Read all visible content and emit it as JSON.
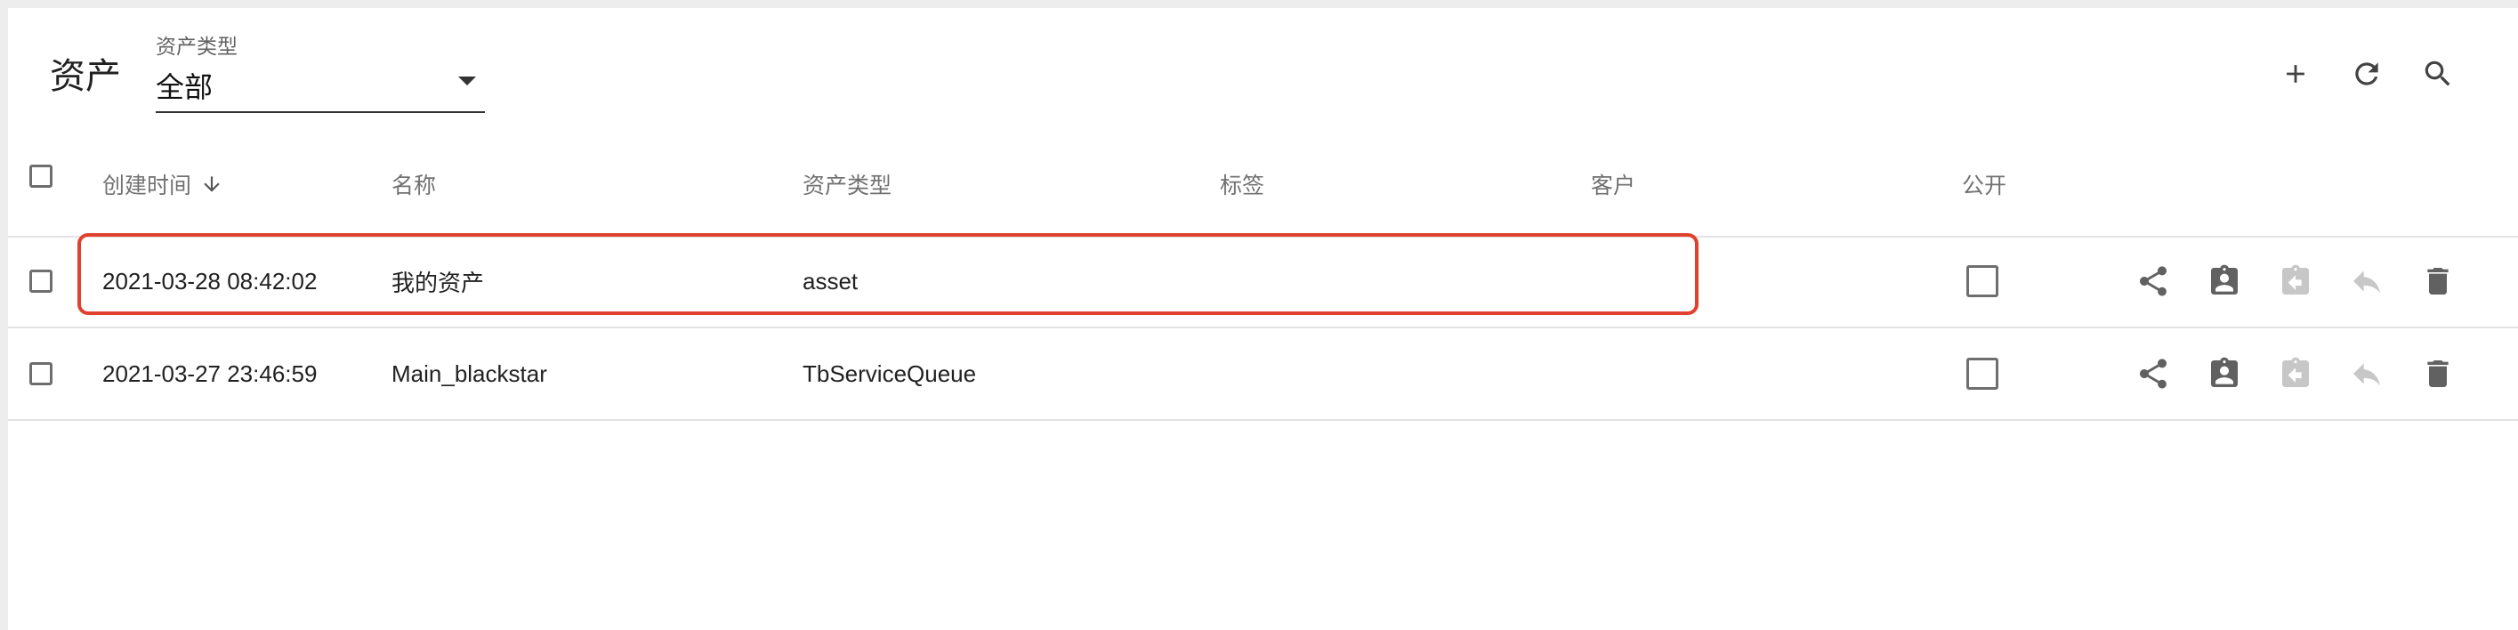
{
  "page": {
    "title": "资产"
  },
  "filter": {
    "label": "资产类型",
    "value": "全部"
  },
  "toolbar": {
    "icons": [
      "add-icon",
      "refresh-icon",
      "search-icon"
    ]
  },
  "table": {
    "columns": [
      "创建时间",
      "名称",
      "资产类型",
      "标签",
      "客户",
      "公开"
    ],
    "sort": {
      "column": "创建时间",
      "direction": "descending"
    },
    "rows": [
      {
        "created": "2021-03-28 08:42:02",
        "name": "我的资产",
        "type": "asset",
        "label": "",
        "customer": "",
        "public": false
      },
      {
        "created": "2021-03-27 23:46:59",
        "name": "Main_blackstar",
        "type": "TbServiceQueue",
        "label": "",
        "customer": "",
        "public": false
      }
    ],
    "row_actions": [
      "share-icon",
      "assign-to-customer-icon",
      "unassign-from-customer-icon",
      "make-private-icon",
      "delete-icon"
    ]
  },
  "colors": {
    "highlight": "#e0412f",
    "icon": "#616161",
    "icon_disabled": "#c7c7c7"
  }
}
